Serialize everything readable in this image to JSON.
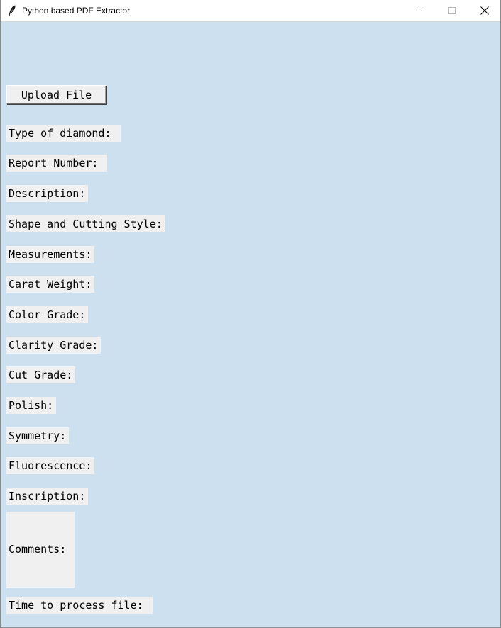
{
  "window": {
    "title": "Python based PDF Extractor",
    "app_icon": "feather-icon",
    "controls": [
      "minimize-icon",
      "maximize-icon",
      "close-icon"
    ]
  },
  "colors": {
    "background": "#cce0f0",
    "label_background": "#f0f0f0",
    "titlebar": "#ffffff"
  },
  "upload_button": {
    "label": "Upload File"
  },
  "fields": [
    {
      "key": "type_of_diamond",
      "label": "Type of diamond: "
    },
    {
      "key": "report_number",
      "label": "Report Number: "
    },
    {
      "key": "description",
      "label": "Description:"
    },
    {
      "key": "shape_and_cutting_style",
      "label": "Shape and Cutting Style:"
    },
    {
      "key": "measurements",
      "label": "Measurements:"
    },
    {
      "key": "carat_weight",
      "label": "Carat Weight:"
    },
    {
      "key": "color_grade",
      "label": "Color Grade:"
    },
    {
      "key": "clarity_grade",
      "label": "Clarity Grade:"
    },
    {
      "key": "cut_grade",
      "label": "Cut Grade:"
    },
    {
      "key": "polish",
      "label": "Polish:"
    },
    {
      "key": "symmetry",
      "label": "Symmetry:"
    },
    {
      "key": "fluorescence",
      "label": "Fluorescence:"
    },
    {
      "key": "inscription",
      "label": "Inscription:"
    },
    {
      "key": "comments",
      "label": "Comments:"
    },
    {
      "key": "time_to_process",
      "label": "Time to process file: "
    }
  ]
}
